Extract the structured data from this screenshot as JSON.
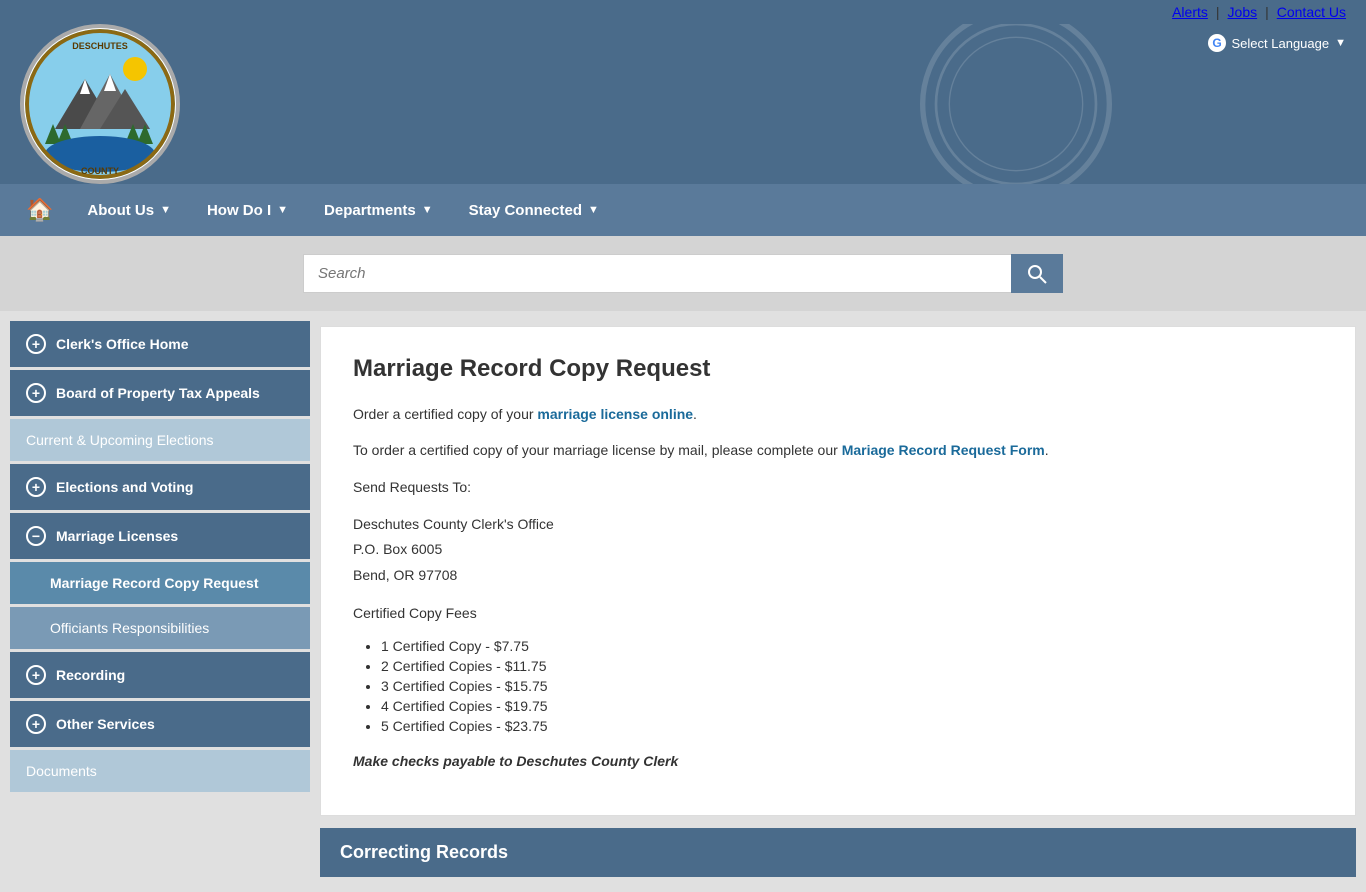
{
  "topbar": {
    "alerts": "Alerts",
    "jobs": "Jobs",
    "contact_us": "Contact Us",
    "select_language": "Select Language"
  },
  "nav": {
    "home_icon": "🏠",
    "items": [
      {
        "label": "About Us",
        "has_arrow": true
      },
      {
        "label": "How Do I",
        "has_arrow": true
      },
      {
        "label": "Departments",
        "has_arrow": true
      },
      {
        "label": "Stay Connected",
        "has_arrow": true
      }
    ]
  },
  "search": {
    "placeholder": "Search"
  },
  "sidebar": {
    "items": [
      {
        "label": "Clerk's Office Home",
        "type": "expandable",
        "expanded": false
      },
      {
        "label": "Board of Property Tax Appeals",
        "type": "expandable",
        "expanded": false
      },
      {
        "label": "Current & Upcoming Elections",
        "type": "plain"
      },
      {
        "label": "Elections and Voting",
        "type": "expandable",
        "expanded": false
      },
      {
        "label": "Marriage Licenses",
        "type": "expandable",
        "expanded": true
      },
      {
        "label": "Marriage Record Copy Request",
        "type": "sub",
        "active": true
      },
      {
        "label": "Officiants Responsibilities",
        "type": "sub",
        "active": false
      },
      {
        "label": "Recording",
        "type": "expandable",
        "expanded": false
      },
      {
        "label": "Other Services",
        "type": "expandable",
        "expanded": false
      },
      {
        "label": "Documents",
        "type": "plain"
      }
    ]
  },
  "main": {
    "page_title": "Marriage Record Copy Request",
    "intro_text": "Order a certified copy of your ",
    "marriage_license_link": "marriage license online",
    "intro_end": ".",
    "mail_text": "To order a certified copy of your marriage license by mail, please complete our ",
    "mail_form_link": "Mariage Record Request Form",
    "mail_end": ".",
    "send_requests_label": "Send Requests To:",
    "address_line1": "Deschutes County Clerk's Office",
    "address_line2": "P.O. Box 6005",
    "address_line3": "Bend, OR 97708",
    "fees_heading": "Certified Copy Fees",
    "fees": [
      "1 Certified Copy - $7.75",
      "2 Certified Copies - $11.75",
      "3 Certified Copies - $15.75",
      "4 Certified Copies - $19.75",
      "5 Certified Copies - $23.75"
    ],
    "make_checks": "Make checks payable to Deschutes County Clerk",
    "second_card_title": "Correcting Records"
  },
  "logo": {
    "county_name": "DESCHUTES COUNTY"
  }
}
